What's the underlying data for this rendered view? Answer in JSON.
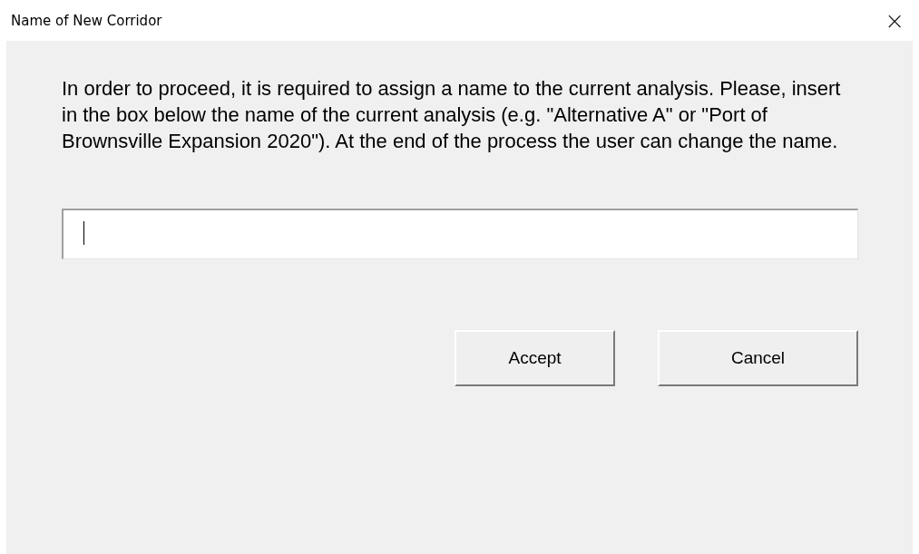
{
  "window": {
    "title": "Name of New Corridor",
    "close": "×"
  },
  "message": "In order to proceed, it is required to assign a name to the current analysis. Please, insert in the box below the name of the current analysis (e.g. \"Alternative A\" or \"Port of Brownsville Expansion 2020\"). At the end of the process the user can change the name.",
  "name_field": {
    "focused": true
  },
  "buttons": [
    "Accept",
    "Cancel"
  ]
}
